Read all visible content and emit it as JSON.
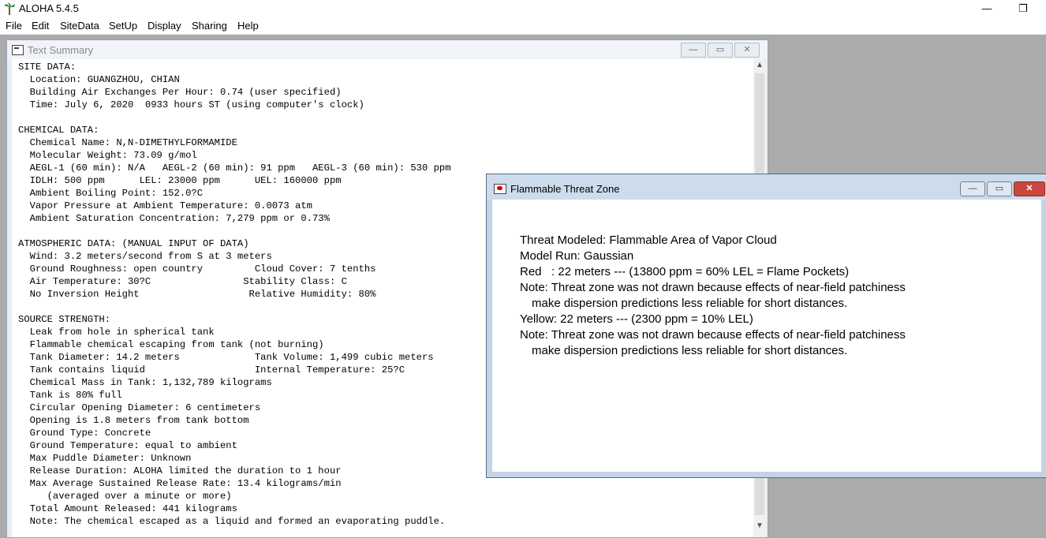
{
  "app": {
    "title": "ALOHA 5.4.5",
    "minimize_label": "—",
    "restore_label": "❐"
  },
  "menu": [
    "File",
    "Edit",
    "SiteData",
    "SetUp",
    "Display",
    "Sharing",
    "Help"
  ],
  "text_summary": {
    "title": "Text Summary",
    "buttons": {
      "minimize": "—",
      "maximize": "▭",
      "close": "✕"
    },
    "lines": [
      "SITE DATA:",
      "  Location: GUANGZHOU, CHIAN",
      "  Building Air Exchanges Per Hour: 0.74 (user specified)",
      "  Time: July 6, 2020  0933 hours ST (using computer's clock)",
      "",
      "CHEMICAL DATA:",
      "  Chemical Name: N,N-DIMETHYLFORMAMIDE",
      "  Molecular Weight: 73.09 g/mol",
      "  AEGL-1 (60 min): N/A   AEGL-2 (60 min): 91 ppm   AEGL-3 (60 min): 530 ppm",
      "  IDLH: 500 ppm      LEL: 23000 ppm      UEL: 160000 ppm",
      "  Ambient Boiling Point: 152.0?C",
      "  Vapor Pressure at Ambient Temperature: 0.0073 atm",
      "  Ambient Saturation Concentration: 7,279 ppm or 0.73%",
      "",
      "ATMOSPHERIC DATA: (MANUAL INPUT OF DATA)",
      "  Wind: 3.2 meters/second from S at 3 meters",
      "  Ground Roughness: open country         Cloud Cover: 7 tenths",
      "  Air Temperature: 30?C                Stability Class: C",
      "  No Inversion Height                   Relative Humidity: 80%",
      "",
      "SOURCE STRENGTH:",
      "  Leak from hole in spherical tank",
      "  Flammable chemical escaping from tank (not burning)",
      "  Tank Diameter: 14.2 meters             Tank Volume: 1,499 cubic meters",
      "  Tank contains liquid                   Internal Temperature: 25?C",
      "  Chemical Mass in Tank: 1,132,789 kilograms",
      "  Tank is 80% full",
      "  Circular Opening Diameter: 6 centimeters",
      "  Opening is 1.8 meters from tank bottom",
      "  Ground Type: Concrete",
      "  Ground Temperature: equal to ambient",
      "  Max Puddle Diameter: Unknown",
      "  Release Duration: ALOHA limited the duration to 1 hour",
      "  Max Average Sustained Release Rate: 13.4 kilograms/min",
      "     (averaged over a minute or more)",
      "  Total Amount Released: 441 kilograms",
      "  Note: The chemical escaped as a liquid and formed an evaporating puddle."
    ]
  },
  "threat_zone": {
    "title": "Flammable Threat Zone",
    "buttons": {
      "minimize": "—",
      "maximize": "▭",
      "close": "✕"
    },
    "lines": [
      "Threat Modeled: Flammable Area of Vapor Cloud",
      "Model Run: Gaussian",
      "Red   : 22 meters --- (13800 ppm = 60% LEL = Flame Pockets)",
      "Note: Threat zone was not drawn because effects of near-field patchiness",
      "make dispersion predictions less reliable for short distances.",
      "Yellow: 22 meters --- (2300 ppm = 10% LEL)",
      "Note: Threat zone was not drawn because effects of near-field patchiness",
      "make dispersion predictions less reliable for short distances."
    ]
  }
}
